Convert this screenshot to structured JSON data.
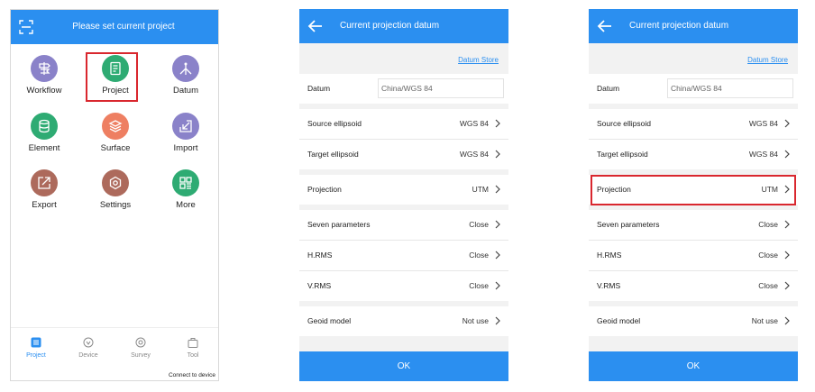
{
  "screen1": {
    "title": "Please set current project",
    "grid": [
      {
        "label": "Workflow",
        "color": "#8a82c9",
        "icon": "signpost-icon"
      },
      {
        "label": "Project",
        "color": "#2eab73",
        "icon": "document-icon"
      },
      {
        "label": "Datum",
        "color": "#8a82c9",
        "icon": "tripod-icon"
      },
      {
        "label": "Element",
        "color": "#2eab73",
        "icon": "database-icon"
      },
      {
        "label": "Surface",
        "color": "#ee7f62",
        "icon": "layers-icon"
      },
      {
        "label": "Import",
        "color": "#8a82c9",
        "icon": "import-icon"
      },
      {
        "label": "Export",
        "color": "#ad6a5c",
        "icon": "export-icon"
      },
      {
        "label": "Settings",
        "color": "#ad6a5c",
        "icon": "gear-icon"
      },
      {
        "label": "More",
        "color": "#2eab73",
        "icon": "grid-icon"
      }
    ],
    "nav": [
      {
        "label": "Project",
        "icon": "list-icon",
        "active": true
      },
      {
        "label": "Device",
        "icon": "device-icon",
        "active": false
      },
      {
        "label": "Survey",
        "icon": "target-icon",
        "active": false
      },
      {
        "label": "Tool",
        "icon": "bag-icon",
        "active": false
      }
    ],
    "connect_text": "Connect to device"
  },
  "datum_screen": {
    "title": "Current projection datum",
    "link": "Datum Store",
    "datum_label": "Datum",
    "datum_value": "China/WGS 84",
    "rows": [
      {
        "label": "Source ellipsoid",
        "value": "WGS 84"
      },
      {
        "label": "Target ellipsoid",
        "value": "WGS 84"
      },
      {
        "label": "Projection",
        "value": "UTM"
      },
      {
        "label": "Seven parameters",
        "value": "Close"
      },
      {
        "label": "H.RMS",
        "value": "Close"
      },
      {
        "label": "V.RMS",
        "value": "Close"
      },
      {
        "label": "Geoid model",
        "value": "Not use"
      }
    ],
    "ok": "OK"
  },
  "colors": {
    "accent": "#2b8ff0",
    "highlight": "#d9272e"
  }
}
